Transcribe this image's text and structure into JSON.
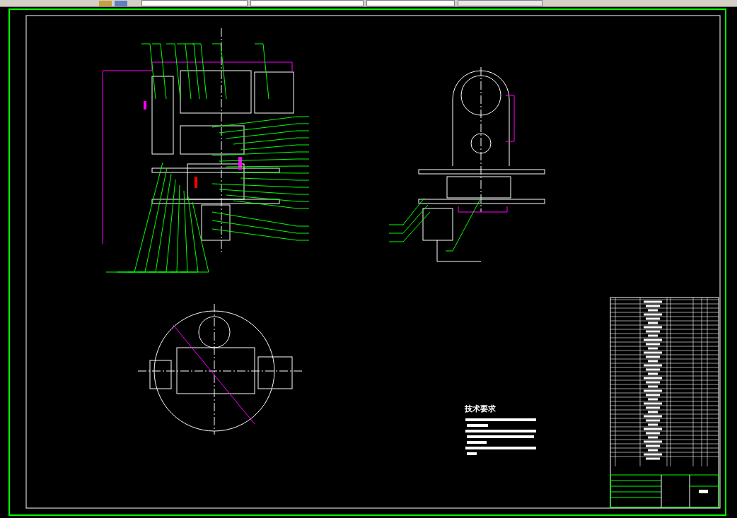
{
  "drawing": {
    "notes_title": "技术要求"
  }
}
